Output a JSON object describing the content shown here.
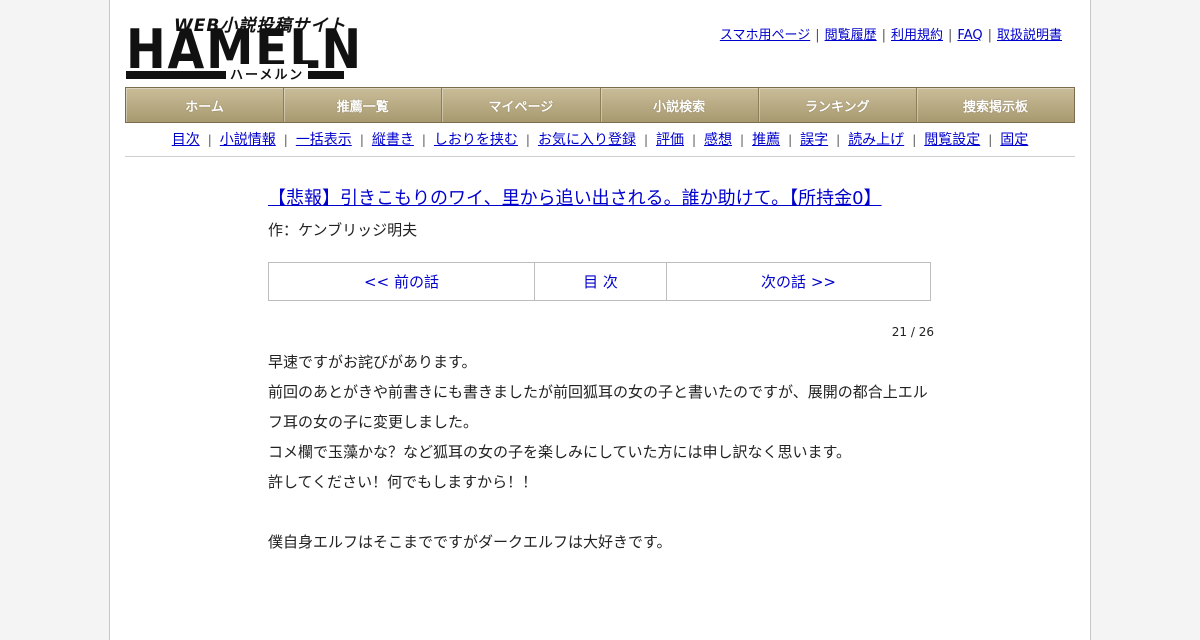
{
  "logo": {
    "tagline": "WEB小説投稿サイト",
    "name": "HAMELN",
    "kana": "ハーメルン"
  },
  "top_links": [
    "スマホ用ページ",
    "閲覧履歴",
    "利用規約",
    "FAQ",
    "取扱説明書"
  ],
  "main_nav": [
    "ホーム",
    "推薦一覧",
    "マイページ",
    "小説検索",
    "ランキング",
    "捜索掲示板"
  ],
  "sub_nav": [
    "目次",
    "小説情報",
    "一括表示",
    "縦書き",
    "しおりを挟む",
    "お気に入り登録",
    "評価",
    "感想",
    "推薦",
    "誤字",
    "読み上げ",
    "閲覧設定",
    "固定"
  ],
  "novel": {
    "title": "【悲報】引きこもりのワイ、里から追い出される。誰か助けて。【所持金0】",
    "author": "作：ケンブリッジ明夫"
  },
  "pager": {
    "prev": "<< 前の話",
    "toc": "目 次",
    "next": "次の話 >>"
  },
  "chapter_counter": "21 / 26",
  "body_lines": [
    "早速ですがお詫びがあります。",
    "前回のあとがきや前書きにも書きましたが前回狐耳の女の子と書いたのですが、展開の都合上エルフ耳の女の子に変更しました。",
    "コメ欄で玉藻かな？など狐耳の女の子を楽しみにしていた方には申し訳なく思います。",
    "許してください！何でもしますから！！",
    "",
    "僕自身エルフはそこまでですがダークエルフは大好きです。"
  ],
  "colors": {
    "link": "#0000cc",
    "nav_bg": "#b8aa80",
    "page_bg": "#f4f4f4"
  }
}
